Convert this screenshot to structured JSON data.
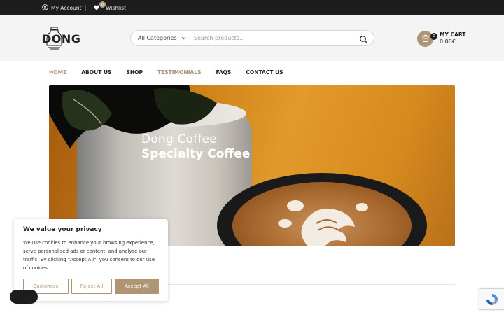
{
  "topbar": {
    "account_label": "My Account",
    "wishlist_label": "Wishlist",
    "wishlist_count": "0"
  },
  "header": {
    "logo_text": "DONG",
    "search": {
      "category_label": "All Categories",
      "placeholder": "Search products..."
    },
    "cart": {
      "label": "MY CART",
      "amount": "0.00€",
      "count": "0"
    }
  },
  "nav": {
    "items": [
      {
        "label": "HOME"
      },
      {
        "label": "ABOUT US"
      },
      {
        "label": "SHOP"
      },
      {
        "label": "TESTIMONIALS"
      },
      {
        "label": "FAQS"
      },
      {
        "label": "CONTACT US"
      }
    ]
  },
  "hero": {
    "line1": "Dong Coffee",
    "line2": "Specialty Coffee"
  },
  "cookie": {
    "title": "We value your privacy",
    "body": "We use cookies to enhance your browsing experience, serve personalised ads or content, and analyse our traffic. By clicking \"Accept All\", you consent to our use of cookies.",
    "customise_label": "Customise",
    "reject_label": "Reject All",
    "accept_label": "Accept All"
  },
  "colors": {
    "accent": "#b09574",
    "topbar_bg": "#1d1d1d",
    "header_bg": "#f4f4f4"
  },
  "icons": [
    "user-icon",
    "heart-icon",
    "chevron-down-icon",
    "search-icon",
    "cart-icon",
    "recaptcha-icon"
  ]
}
